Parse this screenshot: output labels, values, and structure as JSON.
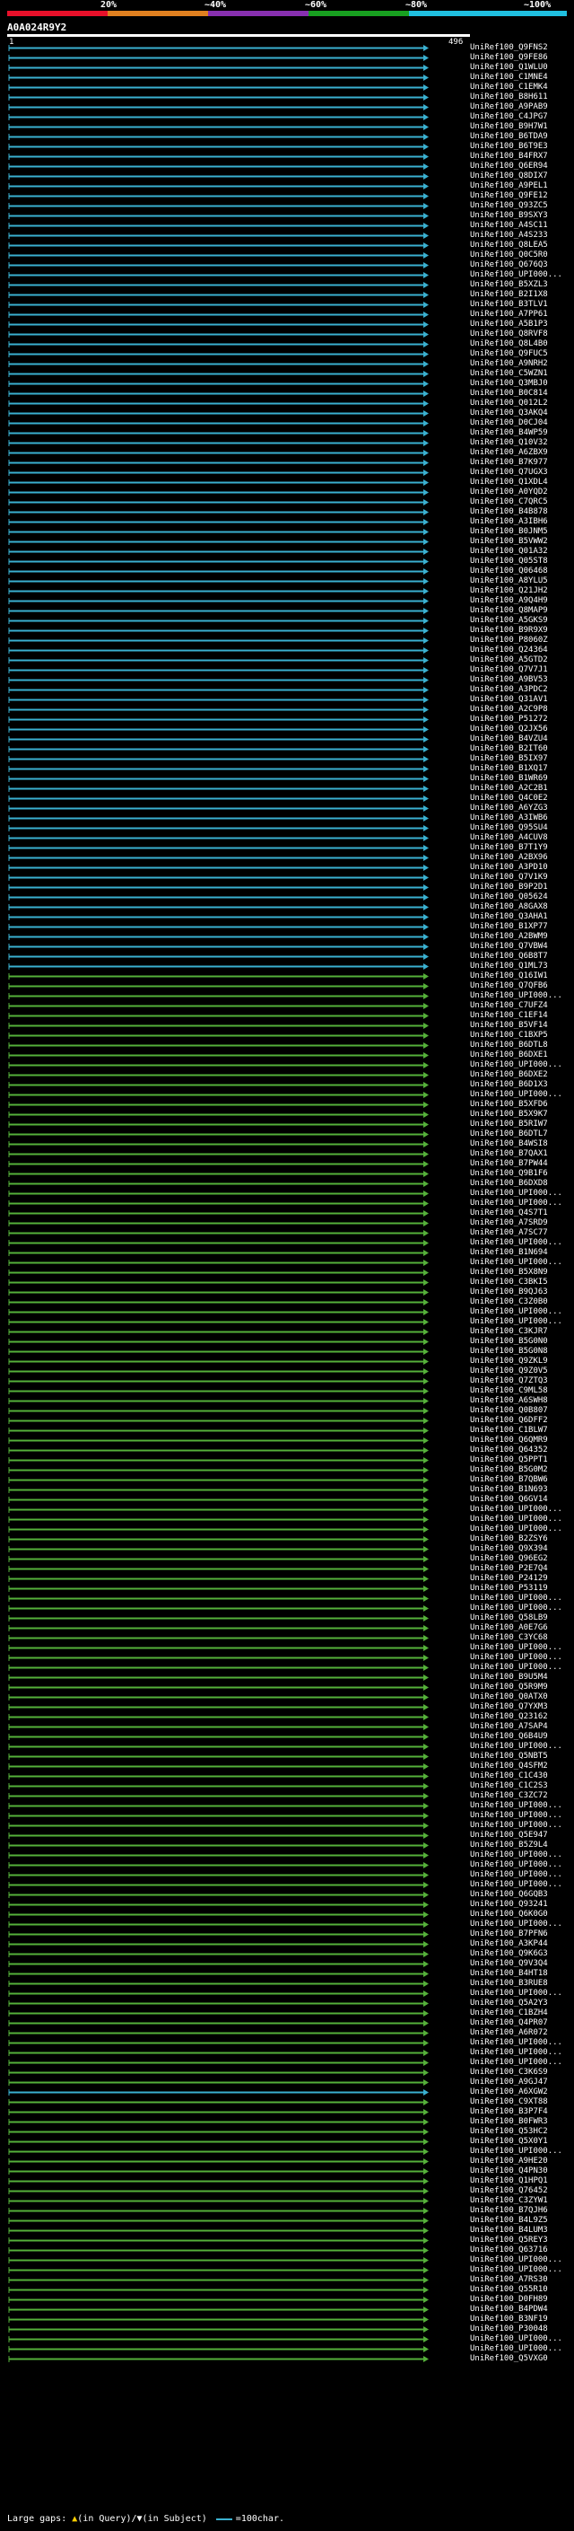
{
  "scale": {
    "labels": [
      "20%",
      "~40%",
      "~60%",
      "~80%",
      "~100%"
    ],
    "colors": [
      "#e8102a",
      "#e08020",
      "#8830b0",
      "#18a020",
      "#20c0e0"
    ]
  },
  "query": {
    "id": "A0A024R9Y2",
    "start": "1",
    "end": "496"
  },
  "colors": {
    "cyan": "#3ab0d0",
    "green": "#55b03a",
    "background": "#000000"
  },
  "hits": [
    {
      "label": "UniRef100_Q9FNS2",
      "c": "cyan"
    },
    {
      "label": "UniRef100_Q9FE86",
      "c": "cyan"
    },
    {
      "label": "UniRef100_Q1WLU0",
      "c": "cyan"
    },
    {
      "label": "UniRef100_C1MNE4",
      "c": "cyan"
    },
    {
      "label": "UniRef100_C1EMK4",
      "c": "cyan"
    },
    {
      "label": "UniRef100_B8H611",
      "c": "cyan"
    },
    {
      "label": "UniRef100_A9PAB9",
      "c": "cyan"
    },
    {
      "label": "UniRef100_C4JPG7",
      "c": "cyan"
    },
    {
      "label": "UniRef100_B9H7W1",
      "c": "cyan"
    },
    {
      "label": "UniRef100_B6TDA9",
      "c": "cyan"
    },
    {
      "label": "UniRef100_B6T9E3",
      "c": "cyan"
    },
    {
      "label": "UniRef100_B4FRX7",
      "c": "cyan"
    },
    {
      "label": "UniRef100_Q6ER94",
      "c": "cyan"
    },
    {
      "label": "UniRef100_Q8DIX7",
      "c": "cyan"
    },
    {
      "label": "UniRef100_A9PEL1",
      "c": "cyan"
    },
    {
      "label": "UniRef100_Q9FE12",
      "c": "cyan"
    },
    {
      "label": "UniRef100_Q93ZC5",
      "c": "cyan"
    },
    {
      "label": "UniRef100_B9SXY3",
      "c": "cyan"
    },
    {
      "label": "UniRef100_A4SC11",
      "c": "cyan"
    },
    {
      "label": "UniRef100_A4S233",
      "c": "cyan"
    },
    {
      "label": "UniRef100_Q8LEA5",
      "c": "cyan"
    },
    {
      "label": "UniRef100_Q0C5R0",
      "c": "cyan"
    },
    {
      "label": "UniRef100_Q676Q3",
      "c": "cyan"
    },
    {
      "label": "UniRef100_UPI000...",
      "c": "cyan"
    },
    {
      "label": "UniRef100_B5XZL3",
      "c": "cyan"
    },
    {
      "label": "UniRef100_B2I1X8",
      "c": "cyan"
    },
    {
      "label": "UniRef100_B3TLV1",
      "c": "cyan"
    },
    {
      "label": "UniRef100_A7PP61",
      "c": "cyan"
    },
    {
      "label": "UniRef100_A5B1P3",
      "c": "cyan"
    },
    {
      "label": "UniRef100_Q8RVF8",
      "c": "cyan"
    },
    {
      "label": "UniRef100_Q8L4B0",
      "c": "cyan"
    },
    {
      "label": "UniRef100_Q9FUC5",
      "c": "cyan"
    },
    {
      "label": "UniRef100_A9NRH2",
      "c": "cyan"
    },
    {
      "label": "UniRef100_C5WZN1",
      "c": "cyan"
    },
    {
      "label": "UniRef100_Q3MBJ0",
      "c": "cyan"
    },
    {
      "label": "UniRef100_B0C814",
      "c": "cyan"
    },
    {
      "label": "UniRef100_Q012L2",
      "c": "cyan"
    },
    {
      "label": "UniRef100_Q3AKQ4",
      "c": "cyan"
    },
    {
      "label": "UniRef100_D0CJ04",
      "c": "cyan"
    },
    {
      "label": "UniRef100_B4WP59",
      "c": "cyan"
    },
    {
      "label": "UniRef100_Q10V32",
      "c": "cyan"
    },
    {
      "label": "UniRef100_A6ZBX9",
      "c": "cyan"
    },
    {
      "label": "UniRef100_B7K977",
      "c": "cyan"
    },
    {
      "label": "UniRef100_Q7UGX3",
      "c": "cyan"
    },
    {
      "label": "UniRef100_Q1XDL4",
      "c": "cyan"
    },
    {
      "label": "UniRef100_A0YQD2",
      "c": "cyan"
    },
    {
      "label": "UniRef100_C7QRC5",
      "c": "cyan"
    },
    {
      "label": "UniRef100_B4B878",
      "c": "cyan"
    },
    {
      "label": "UniRef100_A3IBH6",
      "c": "cyan"
    },
    {
      "label": "UniRef100_B0JNM5",
      "c": "cyan"
    },
    {
      "label": "UniRef100_B5VWW2",
      "c": "cyan"
    },
    {
      "label": "UniRef100_Q01A32",
      "c": "cyan"
    },
    {
      "label": "UniRef100_Q05ST8",
      "c": "cyan"
    },
    {
      "label": "UniRef100_Q06468",
      "c": "cyan"
    },
    {
      "label": "UniRef100_A8YLU5",
      "c": "cyan"
    },
    {
      "label": "UniRef100_Q21JH2",
      "c": "cyan"
    },
    {
      "label": "UniRef100_A9Q4H9",
      "c": "cyan"
    },
    {
      "label": "UniRef100_Q8MAP9",
      "c": "cyan"
    },
    {
      "label": "UniRef100_A5GKS9",
      "c": "cyan"
    },
    {
      "label": "UniRef100_B9R9X9",
      "c": "cyan"
    },
    {
      "label": "UniRef100_P8060Z",
      "c": "cyan"
    },
    {
      "label": "UniRef100_Q24364",
      "c": "cyan"
    },
    {
      "label": "UniRef100_A5GTD2",
      "c": "cyan"
    },
    {
      "label": "UniRef100_Q7V7J1",
      "c": "cyan"
    },
    {
      "label": "UniRef100_A9BV53",
      "c": "cyan"
    },
    {
      "label": "UniRef100_A3PDC2",
      "c": "cyan"
    },
    {
      "label": "UniRef100_Q31AV1",
      "c": "cyan"
    },
    {
      "label": "UniRef100_A2C9P8",
      "c": "cyan"
    },
    {
      "label": "UniRef100_P51272",
      "c": "cyan"
    },
    {
      "label": "UniRef100_Q2JX56",
      "c": "cyan"
    },
    {
      "label": "UniRef100_B4VZU4",
      "c": "cyan"
    },
    {
      "label": "UniRef100_B2IT60",
      "c": "cyan"
    },
    {
      "label": "UniRef100_B5IX97",
      "c": "cyan"
    },
    {
      "label": "UniRef100_B1XQ17",
      "c": "cyan"
    },
    {
      "label": "UniRef100_B1WR69",
      "c": "cyan"
    },
    {
      "label": "UniRef100_A2C2B1",
      "c": "cyan"
    },
    {
      "label": "UniRef100_Q4C0E2",
      "c": "cyan"
    },
    {
      "label": "UniRef100_A6YZG3",
      "c": "cyan"
    },
    {
      "label": "UniRef100_A3IWB6",
      "c": "cyan"
    },
    {
      "label": "UniRef100_Q95SU4",
      "c": "cyan"
    },
    {
      "label": "UniRef100_A4CUV8",
      "c": "cyan"
    },
    {
      "label": "UniRef100_B7T1Y9",
      "c": "cyan"
    },
    {
      "label": "UniRef100_A2BX96",
      "c": "cyan"
    },
    {
      "label": "UniRef100_A3PD10",
      "c": "cyan"
    },
    {
      "label": "UniRef100_Q7V1K9",
      "c": "cyan"
    },
    {
      "label": "UniRef100_B9P2D1",
      "c": "cyan"
    },
    {
      "label": "UniRef100_Q05624",
      "c": "cyan"
    },
    {
      "label": "UniRef100_A8GAX8",
      "c": "cyan"
    },
    {
      "label": "UniRef100_Q3AHA1",
      "c": "cyan"
    },
    {
      "label": "UniRef100_B1XP77",
      "c": "cyan"
    },
    {
      "label": "UniRef100_A2BWM9",
      "c": "cyan"
    },
    {
      "label": "UniRef100_Q7VBW4",
      "c": "cyan"
    },
    {
      "label": "UniRef100_Q6B8T7",
      "c": "cyan"
    },
    {
      "label": "UniRef100_Q1ML73",
      "c": "cyan"
    },
    {
      "label": "UniRef100_Q16IW1",
      "c": "green"
    },
    {
      "label": "UniRef100_Q7QFB6",
      "c": "green"
    },
    {
      "label": "UniRef100_UPI000...",
      "c": "green"
    },
    {
      "label": "UniRef100_C7UFZ4",
      "c": "green"
    },
    {
      "label": "UniRef100_C1EF14",
      "c": "green"
    },
    {
      "label": "UniRef100_B5VF14",
      "c": "green"
    },
    {
      "label": "UniRef100_C1BXP5",
      "c": "green"
    },
    {
      "label": "UniRef100_B6DTL8",
      "c": "green"
    },
    {
      "label": "UniRef100_B6DXE1",
      "c": "green"
    },
    {
      "label": "UniRef100_UPI000...",
      "c": "green"
    },
    {
      "label": "UniRef100_B6DXE2",
      "c": "green"
    },
    {
      "label": "UniRef100_B6D1X3",
      "c": "green"
    },
    {
      "label": "UniRef100_UPI000...",
      "c": "green"
    },
    {
      "label": "UniRef100_B5XFD6",
      "c": "green"
    },
    {
      "label": "UniRef100_B5X9K7",
      "c": "green"
    },
    {
      "label": "UniRef100_B5RIW7",
      "c": "green"
    },
    {
      "label": "UniRef100_B6DTL7",
      "c": "green"
    },
    {
      "label": "UniRef100_B4WSI8",
      "c": "green"
    },
    {
      "label": "UniRef100_B7QAX1",
      "c": "green"
    },
    {
      "label": "UniRef100_B7PW44",
      "c": "green"
    },
    {
      "label": "UniRef100_Q9B1F6",
      "c": "green"
    },
    {
      "label": "UniRef100_B6DXD8",
      "c": "green"
    },
    {
      "label": "UniRef100_UPI000...",
      "c": "green"
    },
    {
      "label": "UniRef100_UPI000...",
      "c": "green"
    },
    {
      "label": "UniRef100_Q4S7T1",
      "c": "green"
    },
    {
      "label": "UniRef100_A7SRD9",
      "c": "green"
    },
    {
      "label": "UniRef100_A7SC77",
      "c": "green"
    },
    {
      "label": "UniRef100_UPI000...",
      "c": "green"
    },
    {
      "label": "UniRef100_B1N694",
      "c": "green"
    },
    {
      "label": "UniRef100_UPI000...",
      "c": "green"
    },
    {
      "label": "UniRef100_B5X8N9",
      "c": "green"
    },
    {
      "label": "UniRef100_C3BKI5",
      "c": "green"
    },
    {
      "label": "UniRef100_B9QJ63",
      "c": "green"
    },
    {
      "label": "UniRef100_C3Z0B0",
      "c": "green"
    },
    {
      "label": "UniRef100_UPI000...",
      "c": "green"
    },
    {
      "label": "UniRef100_UPI000...",
      "c": "green"
    },
    {
      "label": "UniRef100_C3KJR7",
      "c": "green"
    },
    {
      "label": "UniRef100_B5G0N0",
      "c": "green"
    },
    {
      "label": "UniRef100_B5G0N8",
      "c": "green"
    },
    {
      "label": "UniRef100_Q9ZKL9",
      "c": "green"
    },
    {
      "label": "UniRef100_Q9Z0V5",
      "c": "green"
    },
    {
      "label": "UniRef100_Q7ZTQ3",
      "c": "green"
    },
    {
      "label": "UniRef100_C9ML58",
      "c": "green"
    },
    {
      "label": "UniRef100_A6SWH8",
      "c": "green"
    },
    {
      "label": "UniRef100_Q0B807",
      "c": "green"
    },
    {
      "label": "UniRef100_Q6DFF2",
      "c": "green"
    },
    {
      "label": "UniRef100_C1BLW7",
      "c": "green"
    },
    {
      "label": "UniRef100_Q6QMR9",
      "c": "green"
    },
    {
      "label": "UniRef100_Q64352",
      "c": "green"
    },
    {
      "label": "UniRef100_Q5PPT1",
      "c": "green"
    },
    {
      "label": "UniRef100_B5G0M2",
      "c": "green"
    },
    {
      "label": "UniRef100_B7QBW6",
      "c": "green"
    },
    {
      "label": "UniRef100_B1N693",
      "c": "green"
    },
    {
      "label": "UniRef100_Q6GV14",
      "c": "green"
    },
    {
      "label": "UniRef100_UPI000...",
      "c": "green"
    },
    {
      "label": "UniRef100_UPI000...",
      "c": "green"
    },
    {
      "label": "UniRef100_UPI000...",
      "c": "green"
    },
    {
      "label": "UniRef100_B2ZSY6",
      "c": "green"
    },
    {
      "label": "UniRef100_Q9X394",
      "c": "green"
    },
    {
      "label": "UniRef100_Q96EG2",
      "c": "green"
    },
    {
      "label": "UniRef100_P2E7Q4",
      "c": "green"
    },
    {
      "label": "UniRef100_P24129",
      "c": "green"
    },
    {
      "label": "UniRef100_P53119",
      "c": "green"
    },
    {
      "label": "UniRef100_UPI000...",
      "c": "green"
    },
    {
      "label": "UniRef100_UPI000...",
      "c": "green"
    },
    {
      "label": "UniRef100_Q58LB9",
      "c": "green"
    },
    {
      "label": "UniRef100_A0E7G6",
      "c": "green"
    },
    {
      "label": "UniRef100_C3YC68",
      "c": "green"
    },
    {
      "label": "UniRef100_UPI000...",
      "c": "green"
    },
    {
      "label": "UniRef100_UPI000...",
      "c": "green"
    },
    {
      "label": "UniRef100_UPI000...",
      "c": "green"
    },
    {
      "label": "UniRef100_B9U5M4",
      "c": "green"
    },
    {
      "label": "UniRef100_Q5R9M9",
      "c": "green"
    },
    {
      "label": "UniRef100_Q0ATX0",
      "c": "green"
    },
    {
      "label": "UniRef100_Q7YXM3",
      "c": "green"
    },
    {
      "label": "UniRef100_Q23162",
      "c": "green"
    },
    {
      "label": "UniRef100_A7SAP4",
      "c": "green"
    },
    {
      "label": "UniRef100_Q6B4U9",
      "c": "green"
    },
    {
      "label": "UniRef100_UPI000...",
      "c": "green"
    },
    {
      "label": "UniRef100_Q5NBT5",
      "c": "green"
    },
    {
      "label": "UniRef100_Q4SFM2",
      "c": "green"
    },
    {
      "label": "UniRef100_C1C430",
      "c": "green"
    },
    {
      "label": "UniRef100_C1C2S3",
      "c": "green"
    },
    {
      "label": "UniRef100_C3ZC72",
      "c": "green"
    },
    {
      "label": "UniRef100_UPI000...",
      "c": "green"
    },
    {
      "label": "UniRef100_UPI000...",
      "c": "green"
    },
    {
      "label": "UniRef100_UPI000...",
      "c": "green"
    },
    {
      "label": "UniRef100_Q5E947",
      "c": "green"
    },
    {
      "label": "UniRef100_B5Z9L4",
      "c": "green"
    },
    {
      "label": "UniRef100_UPI000...",
      "c": "green"
    },
    {
      "label": "UniRef100_UPI000...",
      "c": "green"
    },
    {
      "label": "UniRef100_UPI000...",
      "c": "green"
    },
    {
      "label": "UniRef100_UPI000...",
      "c": "green"
    },
    {
      "label": "UniRef100_Q6GQB3",
      "c": "green"
    },
    {
      "label": "UniRef100_Q93241",
      "c": "green"
    },
    {
      "label": "UniRef100_Q6K0G0",
      "c": "green"
    },
    {
      "label": "UniRef100_UPI000...",
      "c": "green"
    },
    {
      "label": "UniRef100_B7PFN6",
      "c": "green"
    },
    {
      "label": "UniRef100_A3KP44",
      "c": "green"
    },
    {
      "label": "UniRef100_Q9K6G3",
      "c": "green"
    },
    {
      "label": "UniRef100_Q9V3Q4",
      "c": "green"
    },
    {
      "label": "UniRef100_B4HT18",
      "c": "green"
    },
    {
      "label": "UniRef100_B3RUE8",
      "c": "green"
    },
    {
      "label": "UniRef100_UPI000...",
      "c": "green"
    },
    {
      "label": "UniRef100_Q5A2Y3",
      "c": "green"
    },
    {
      "label": "UniRef100_C1BZH4",
      "c": "green"
    },
    {
      "label": "UniRef100_Q4PR07",
      "c": "green"
    },
    {
      "label": "UniRef100_A6R072",
      "c": "green"
    },
    {
      "label": "UniRef100_UPI000...",
      "c": "green"
    },
    {
      "label": "UniRef100_UPI000...",
      "c": "green"
    },
    {
      "label": "UniRef100_UPI000...",
      "c": "green"
    },
    {
      "label": "UniRef100_C3K6S9",
      "c": "green"
    },
    {
      "label": "UniRef100_A9GJ47",
      "c": "green"
    },
    {
      "label": "UniRef100_A6XGW2",
      "c": "cyan"
    },
    {
      "label": "UniRef100_C9XT88",
      "c": "green"
    },
    {
      "label": "UniRef100_B3P7F4",
      "c": "green"
    },
    {
      "label": "UniRef100_B0FWR3",
      "c": "green"
    },
    {
      "label": "UniRef100_Q53HC2",
      "c": "green"
    },
    {
      "label": "UniRef100_Q5X0Y1",
      "c": "green"
    },
    {
      "label": "UniRef100_UPI000...",
      "c": "green"
    },
    {
      "label": "UniRef100_A9HE20",
      "c": "green"
    },
    {
      "label": "UniRef100_Q4PN30",
      "c": "green"
    },
    {
      "label": "UniRef100_Q1HPQ1",
      "c": "green"
    },
    {
      "label": "UniRef100_Q76452",
      "c": "green"
    },
    {
      "label": "UniRef100_C3ZYW1",
      "c": "green"
    },
    {
      "label": "UniRef100_B7QJH6",
      "c": "green"
    },
    {
      "label": "UniRef100_B4L9Z5",
      "c": "green"
    },
    {
      "label": "UniRef100_B4LUM3",
      "c": "green"
    },
    {
      "label": "UniRef100_Q5REY3",
      "c": "green"
    },
    {
      "label": "UniRef100_Q63716",
      "c": "green"
    },
    {
      "label": "UniRef100_UPI000...",
      "c": "green"
    },
    {
      "label": "UniRef100_UPI000...",
      "c": "green"
    },
    {
      "label": "UniRef100_A7RS30",
      "c": "green"
    },
    {
      "label": "UniRef100_Q55R10",
      "c": "green"
    },
    {
      "label": "UniRef100_D0FH89",
      "c": "green"
    },
    {
      "label": "UniRef100_B4PDW4",
      "c": "green"
    },
    {
      "label": "UniRef100_B3NF19",
      "c": "green"
    },
    {
      "label": "UniRef100_P30048",
      "c": "green"
    },
    {
      "label": "UniRef100_UPI000...",
      "c": "green"
    },
    {
      "label": "UniRef100_UPI000...",
      "c": "green"
    },
    {
      "label": "UniRef100_Q5VXG0",
      "c": "green"
    }
  ],
  "legend": {
    "text": "Large gaps: ",
    "query_text": "(in Query)/",
    "subject_text": "(in Subject)",
    "scale_text": "=100char."
  }
}
